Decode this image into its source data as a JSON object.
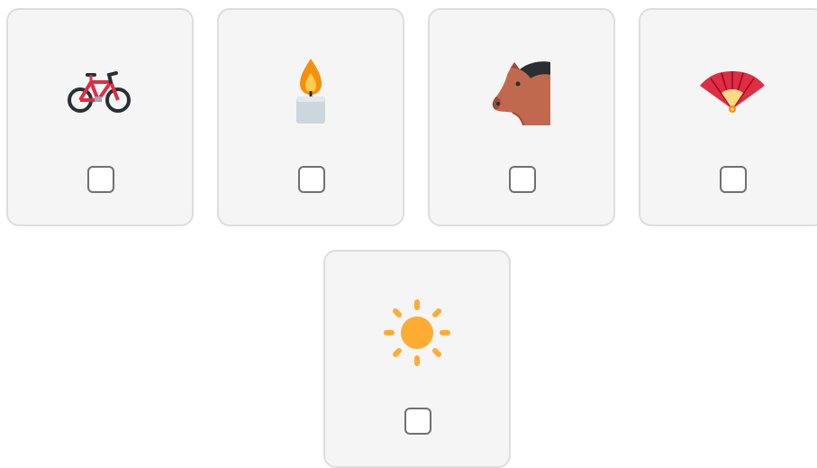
{
  "cards": [
    {
      "icon": "bicycle-icon",
      "checked": false
    },
    {
      "icon": "candle-icon",
      "checked": false
    },
    {
      "icon": "horse-face-icon",
      "checked": false
    },
    {
      "icon": "folding-hand-fan-icon",
      "checked": false
    },
    {
      "icon": "sun-icon",
      "checked": false
    }
  ],
  "colors": {
    "card_background": "#f5f5f5",
    "card_border": "#dddddd",
    "checkbox_border": "#707070"
  }
}
